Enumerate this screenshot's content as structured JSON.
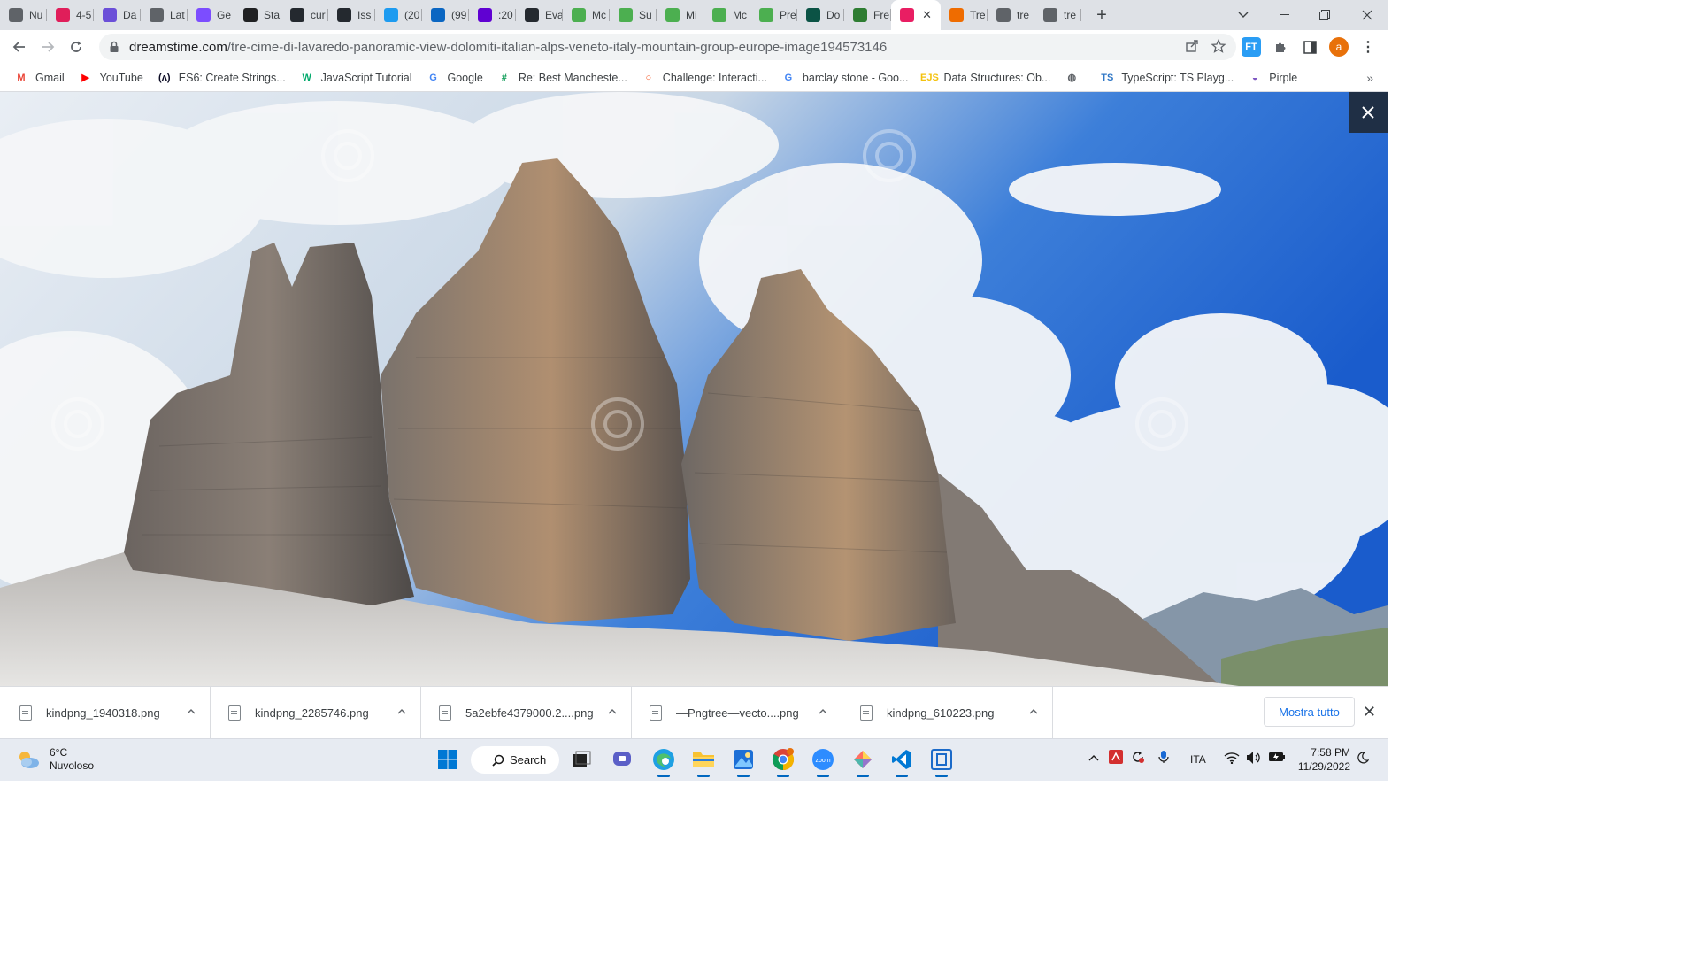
{
  "browser": {
    "tabs": [
      {
        "title": "Nu",
        "icon": "globe-icon",
        "color": "#5f6368"
      },
      {
        "title": "4-5",
        "icon": "slack-icon",
        "color": "#e01e5a"
      },
      {
        "title": "Da",
        "icon": "dalle-icon",
        "color": "#6b4fd8"
      },
      {
        "title": "Lat",
        "icon": "globe-icon",
        "color": "#5f6368"
      },
      {
        "title": "Ge",
        "icon": "geometry-icon",
        "color": "#7c4dff"
      },
      {
        "title": "Sta",
        "icon": "openai-icon",
        "color": "#202123"
      },
      {
        "title": "cur",
        "icon": "github-icon",
        "color": "#24292f"
      },
      {
        "title": "Iss",
        "icon": "github-icon",
        "color": "#24292f"
      },
      {
        "title": "(20",
        "icon": "twitter-icon",
        "color": "#1d9bf0"
      },
      {
        "title": "(99",
        "icon": "linkedin-icon",
        "color": "#0a66c2"
      },
      {
        "title": ":20",
        "icon": "yahoo-icon",
        "color": "#6001d2"
      },
      {
        "title": "Eva",
        "icon": "github-icon",
        "color": "#24292f"
      },
      {
        "title": "Mc",
        "icon": "codewars-icon",
        "color": "#4caf50"
      },
      {
        "title": "Su",
        "icon": "codewars-icon",
        "color": "#4caf50"
      },
      {
        "title": "Mi",
        "icon": "codewars-icon",
        "color": "#4caf50"
      },
      {
        "title": "Mc",
        "icon": "codewars-icon",
        "color": "#4caf50"
      },
      {
        "title": "Pre",
        "icon": "codewars-icon",
        "color": "#4caf50"
      },
      {
        "title": "Do",
        "icon": "kp-icon",
        "color": "#0b5345"
      },
      {
        "title": "Fre",
        "icon": "leaf-icon",
        "color": "#2e7d32"
      },
      {
        "title": "",
        "icon": "dreamstime-icon",
        "color": "#e91e63",
        "active": true
      },
      {
        "title": "Tre",
        "icon": "bird-icon",
        "color": "#ef6c00"
      },
      {
        "title": "tre",
        "icon": "globe-icon",
        "color": "#5f6368"
      },
      {
        "title": "tre",
        "icon": "globe-icon",
        "color": "#5f6368"
      }
    ],
    "url_host": "dreamstime.com",
    "url_path": "/tre-cime-di-lavaredo-panoramic-view-dolomiti-italian-alps-veneto-italy-mountain-group-europe-image194573146",
    "profile_letter": "a",
    "ext_label": "FT"
  },
  "bookmarks": [
    {
      "label": "Gmail",
      "icon": "gmail-icon",
      "color": "#ea4335",
      "glyph": "M"
    },
    {
      "label": "YouTube",
      "icon": "youtube-icon",
      "color": "#ff0000",
      "glyph": "▶"
    },
    {
      "label": "ES6: Create Strings...",
      "icon": "freecodecamp-icon",
      "color": "#0a0a23",
      "glyph": "(ʌ)"
    },
    {
      "label": "JavaScript Tutorial",
      "icon": "w3schools-icon",
      "color": "#04aa6d",
      "glyph": "W"
    },
    {
      "label": "Google",
      "icon": "google-icon",
      "color": "#4285f4",
      "glyph": "G"
    },
    {
      "label": "Re: Best Mancheste...",
      "icon": "grid-icon",
      "color": "#0f9d58",
      "glyph": "#"
    },
    {
      "label": "Challenge: Interacti...",
      "icon": "ring-icon",
      "color": "#f4511e",
      "glyph": "○"
    },
    {
      "label": "barclay stone - Goo...",
      "icon": "google-icon",
      "color": "#4285f4",
      "glyph": "G"
    },
    {
      "label": "Data Structures: Ob...",
      "icon": "ejs-icon",
      "color": "#f4c20d",
      "glyph": "EJS"
    },
    {
      "label": "",
      "icon": "globe-icon",
      "color": "#5f6368",
      "glyph": "◍"
    },
    {
      "label": "TypeScript: TS Playg...",
      "icon": "typescript-icon",
      "color": "#3178c6",
      "glyph": "TS"
    },
    {
      "label": "Pirple",
      "icon": "pirple-icon",
      "color": "#7e57c2",
      "glyph": "◒"
    }
  ],
  "downloads": {
    "items": [
      {
        "name": "kindpng_1940318.png"
      },
      {
        "name": "kindpng_2285746.png"
      },
      {
        "name": "5a2ebfe4379000.2....png"
      },
      {
        "name": "—Pngtree—vecto....png"
      },
      {
        "name": "kindpng_610223.png"
      }
    ],
    "show_all": "Mostra tutto"
  },
  "taskbar": {
    "weather_temp": "6°C",
    "weather_desc": "Nuvoloso",
    "search_label": "Search",
    "lang": "ITA",
    "time": "7:58 PM",
    "date": "11/29/2022"
  }
}
